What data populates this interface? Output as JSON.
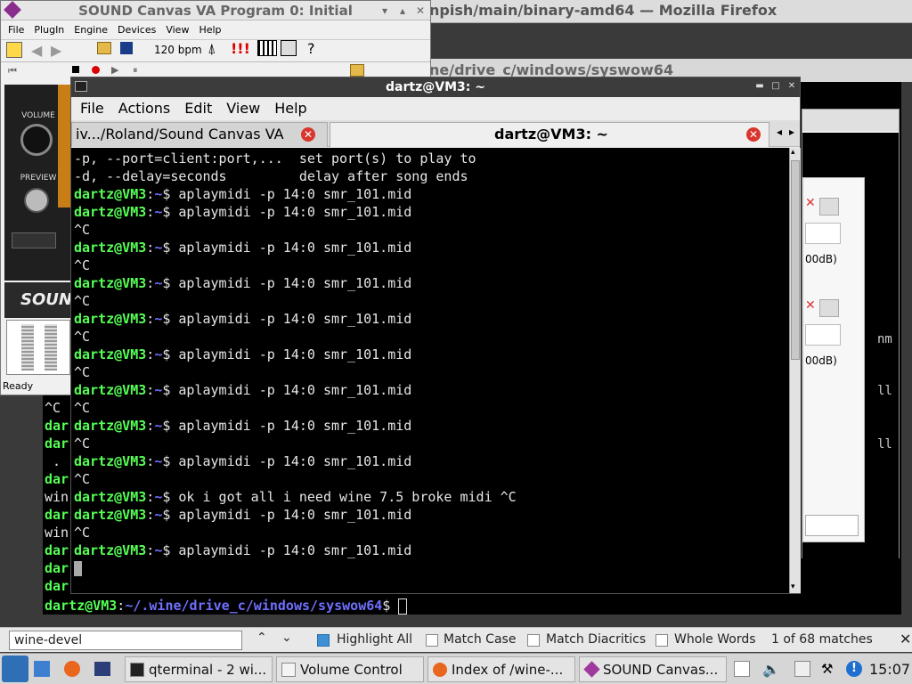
{
  "firefox": {
    "title": "npish/main/binary-amd64 — Mozilla Firefox",
    "url_strip": "ne/drive_c/windows/syswow64",
    "find": {
      "query": "wine-devel",
      "highlight_all": "Highlight All",
      "match_case": "Match Case",
      "match_diacritics": "Match Diacritics",
      "whole_words": "Whole Words",
      "status": "1 of 68 matches"
    }
  },
  "volume_control": {
    "label_a": "00dB)",
    "label_b": "00dB)",
    "side_a": "nm",
    "side_b": "ll",
    "side_c": "ll"
  },
  "back_terminal": {
    "lines": [
      {
        "cls": "w",
        "text": "^C"
      },
      {
        "cls": "g",
        "text": "dar"
      },
      {
        "cls": "g",
        "text": "dar"
      },
      {
        "cls": "w",
        "text": " ."
      },
      {
        "cls": "g",
        "text": "dar"
      },
      {
        "cls": "w",
        "text": "win"
      },
      {
        "cls": "g",
        "text": "dar"
      },
      {
        "cls": "w",
        "text": "win"
      },
      {
        "cls": "g",
        "text": "dar"
      },
      {
        "cls": "g",
        "text": "dar"
      },
      {
        "cls": "g",
        "text": "dar"
      }
    ],
    "prompt_user": "dartz@VM3",
    "prompt_sep": ":",
    "prompt_path": "~/.wine/drive_c/windows/syswow64",
    "prompt_end": "$ "
  },
  "sound_canvas": {
    "title": "SOUND Canvas VA Program 0: Initial",
    "menu": [
      "File",
      "PlugIn",
      "Engine",
      "Devices",
      "View",
      "Help"
    ],
    "bpm": "120 bpm",
    "volume_label": "VOLUME",
    "preview_label": "PREVIEW",
    "logo": "SOUN",
    "status": "Ready"
  },
  "terminal": {
    "title": "dartz@VM3: ~",
    "menu": [
      "File",
      "Actions",
      "Edit",
      "View",
      "Help"
    ],
    "tabs": [
      {
        "label": "iv.../Roland/Sound Canvas VA"
      },
      {
        "label": "dartz@VM3: ~"
      }
    ],
    "user": "dartz@VM3",
    "path": "~",
    "lines": [
      {
        "type": "plain",
        "text": "-p, --port=client:port,...  set port(s) to play to"
      },
      {
        "type": "plain",
        "text": "-d, --delay=seconds         delay after song ends"
      },
      {
        "type": "cmd",
        "text": "aplaymidi -p 14:0 smr_101.mid"
      },
      {
        "type": "cmd",
        "text": "aplaymidi -p 14:0 smr_101.mid"
      },
      {
        "type": "plain",
        "text": "^C"
      },
      {
        "type": "cmd",
        "text": "aplaymidi -p 14:0 smr_101.mid"
      },
      {
        "type": "plain",
        "text": "^C"
      },
      {
        "type": "cmd",
        "text": "aplaymidi -p 14:0 smr_101.mid"
      },
      {
        "type": "plain",
        "text": "^C"
      },
      {
        "type": "cmd",
        "text": "aplaymidi -p 14:0 smr_101.mid"
      },
      {
        "type": "plain",
        "text": "^C"
      },
      {
        "type": "cmd",
        "text": "aplaymidi -p 14:0 smr_101.mid"
      },
      {
        "type": "plain",
        "text": "^C"
      },
      {
        "type": "cmd",
        "text": "aplaymidi -p 14:0 smr_101.mid"
      },
      {
        "type": "plain",
        "text": "^C"
      },
      {
        "type": "cmd",
        "text": "aplaymidi -p 14:0 smr_101.mid"
      },
      {
        "type": "plain",
        "text": "^C"
      },
      {
        "type": "cmd",
        "text": "aplaymidi -p 14:0 smr_101.mid"
      },
      {
        "type": "plain",
        "text": "^C"
      },
      {
        "type": "cmd",
        "text": "ok i got all i need wine 7.5 broke midi ^C"
      },
      {
        "type": "cmd",
        "text": "aplaymidi -p 14:0 smr_101.mid"
      },
      {
        "type": "plain",
        "text": "^C"
      },
      {
        "type": "cmd",
        "text": "aplaymidi -p 14:0 smr_101.mid"
      },
      {
        "type": "cursor",
        "text": ""
      }
    ]
  },
  "taskbar": {
    "tasks": [
      {
        "label": "qterminal - 2 wi...",
        "icon": "terminal-icon"
      },
      {
        "label": "Volume Control",
        "icon": "volume-control-icon"
      },
      {
        "label": "Index of /wine-...",
        "icon": "firefox-icon"
      },
      {
        "label": "SOUND Canvas...",
        "icon": "sound-canvas-icon"
      }
    ],
    "clock": "15:07"
  },
  "colors": {
    "prompt_user": "#55ff55",
    "prompt_path": "#6f6fff",
    "tab_close": "#d9352c",
    "titlebar_dark": "#3c3c3c"
  }
}
